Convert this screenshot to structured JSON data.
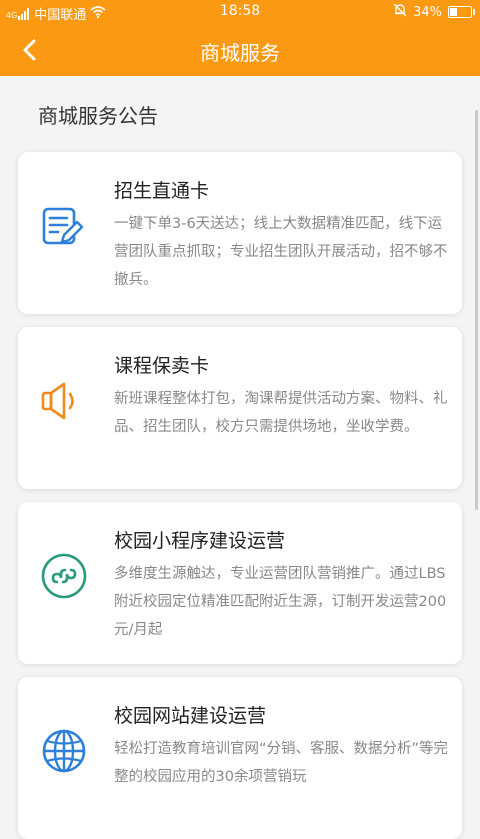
{
  "status_bar": {
    "signal_label": "4G",
    "carrier": "中国联通",
    "time": "18:58",
    "battery_percent": "34%",
    "battery_level": 0.34,
    "icons": [
      "signal-icon",
      "wifi-icon",
      "mute-bell-icon",
      "battery-icon"
    ]
  },
  "nav": {
    "title": "商城服务",
    "back_icon": "chevron-left-icon"
  },
  "section_title": "商城服务公告",
  "cards": [
    {
      "icon": "edit-document-icon",
      "title": "招生直通卡",
      "desc": "一键下单3-6天送达；线上大数据精准匹配，线下运营团队重点抓取；专业招生团队开展活动，招不够不撤兵。"
    },
    {
      "icon": "speaker-icon",
      "title": "课程保卖卡",
      "desc": "新班课程整体打包，淘课帮提供活动方案、物料、礼品、招生团队，校方只需提供场地，坐收学费。"
    },
    {
      "icon": "mini-program-icon",
      "title": "校园小程序建设运营",
      "desc": "多维度生源触达，专业运营团队营销推广。通过LBS附近校园定位精准匹配附近生源，订制开发运营200元/月起"
    },
    {
      "icon": "globe-icon",
      "title": "校园网站建设运营",
      "desc": "轻松打造教育培训官网“分销、客服、数据分析”等完整的校园应用的30余项营销玩"
    }
  ],
  "colors": {
    "brand": "#fb9a12",
    "icon_blue": "#2d7fd9",
    "icon_orange": "#f08a1c",
    "icon_green": "#2a9a7f"
  }
}
